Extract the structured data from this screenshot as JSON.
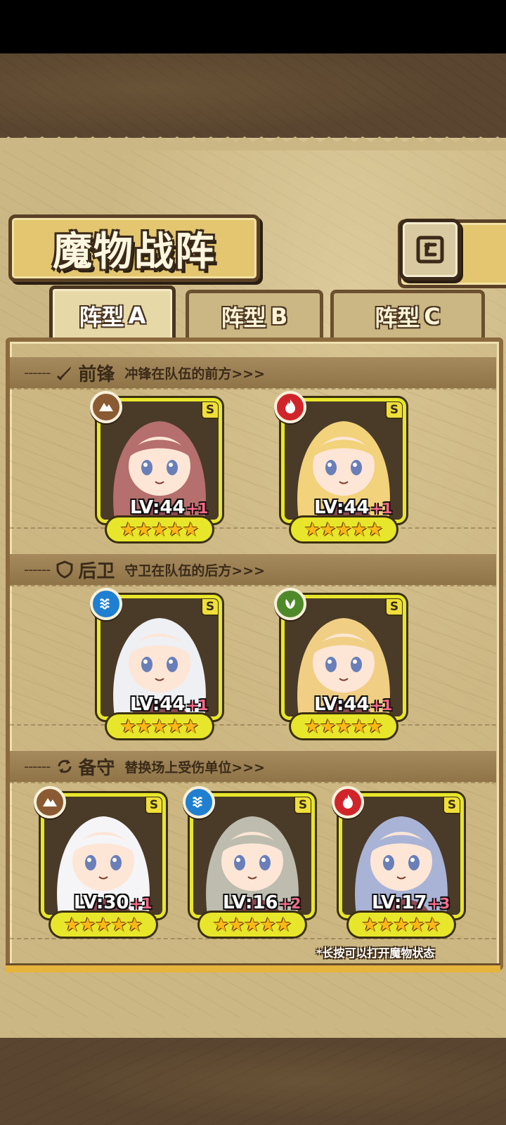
{
  "header": {
    "title": "魔物战阵",
    "back_icon": "back-arrow-icon"
  },
  "tabs": [
    {
      "label": "阵型",
      "letter": "A",
      "active": true
    },
    {
      "label": "阵型",
      "letter": "B",
      "active": false
    },
    {
      "label": "阵型",
      "letter": "C",
      "active": false
    }
  ],
  "sections": {
    "front": {
      "title": "前锋",
      "desc": "冲锋在队伍的前方>>>",
      "icon": "sword-icon"
    },
    "back": {
      "title": "后卫",
      "desc": "守卫在队伍的后方>>>",
      "icon": "shield-icon"
    },
    "reserve": {
      "title": "备守",
      "desc": "替换场上受伤单位>>>",
      "icon": "swap-icon"
    }
  },
  "cards": [
    {
      "level": "LV:44",
      "bonus": "+1",
      "rank": "S",
      "stars": 5,
      "element": "earth",
      "element_color": "#8a5a32",
      "hair": "#b56f6c"
    },
    {
      "level": "LV:44",
      "bonus": "+1",
      "rank": "S",
      "stars": 5,
      "element": "fire",
      "element_color": "#d1242a",
      "hair": "#f2d27a"
    },
    {
      "level": "LV:44",
      "bonus": "+1",
      "rank": "S",
      "stars": 5,
      "element": "water",
      "element_color": "#1f7fd0",
      "hair": "#eef0f4"
    },
    {
      "level": "LV:44",
      "bonus": "+1",
      "rank": "S",
      "stars": 5,
      "element": "wind",
      "element_color": "#4f8a2a",
      "hair": "#f0cf84"
    },
    {
      "level": "LV:30",
      "bonus": "+1",
      "rank": "S",
      "stars": 5,
      "element": "earth",
      "element_color": "#8a5a32",
      "hair": "#f5f5f7"
    },
    {
      "level": "LV:16",
      "bonus": "+2",
      "rank": "S",
      "stars": 5,
      "element": "water",
      "element_color": "#1f7fd0",
      "hair": "#bdbcae"
    },
    {
      "level": "LV:17",
      "bonus": "+3",
      "rank": "S",
      "stars": 5,
      "element": "fire",
      "element_color": "#d1242a",
      "hair": "#a9b3d6"
    }
  ],
  "footnote": "*长按可以打开魔物状态"
}
